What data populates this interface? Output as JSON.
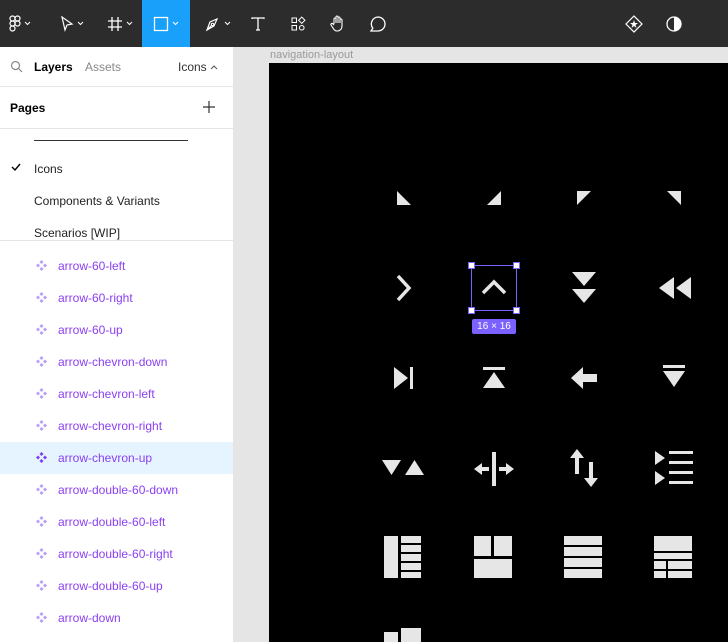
{
  "toolbar": {
    "tools": [
      "figma-menu",
      "move",
      "frame",
      "shape",
      "pen",
      "text",
      "components",
      "hand",
      "comment"
    ],
    "active_tool": "shape",
    "accent": "#18a0fb"
  },
  "panel": {
    "tabs": {
      "layers": "Layers",
      "assets": "Assets",
      "page": "Icons"
    },
    "pages_title": "Pages",
    "pages": [
      {
        "label": "Icons",
        "current": true
      },
      {
        "label": "Components & Variants",
        "current": false
      },
      {
        "label": "Scenarios [WIP]",
        "current": false
      }
    ],
    "layers": [
      "arrow-60-left",
      "arrow-60-right",
      "arrow-60-up",
      "arrow-chevron-down",
      "arrow-chevron-left",
      "arrow-chevron-right",
      "arrow-chevron-up",
      "arrow-double-60-down",
      "arrow-double-60-left",
      "arrow-double-60-right",
      "arrow-double-60-up",
      "arrow-down"
    ],
    "selected_layer": "arrow-chevron-up"
  },
  "canvas": {
    "frame_name": "navigation-layout",
    "selection_size": "16 × 16",
    "selection_color": "#7b61ff"
  }
}
